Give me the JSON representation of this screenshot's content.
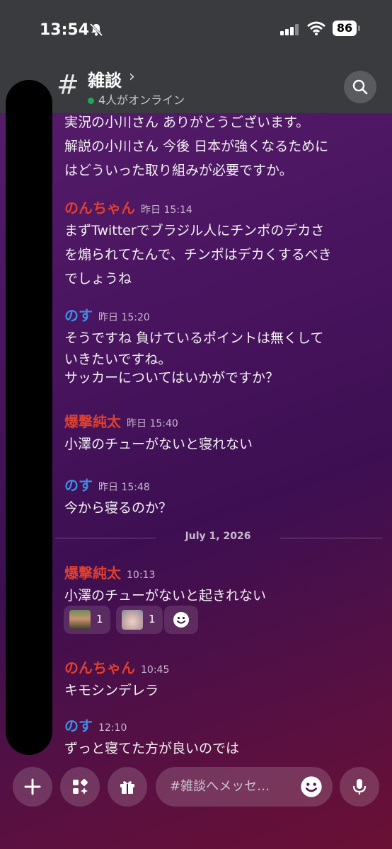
{
  "status": {
    "time": "13:54",
    "battery": "86"
  },
  "header": {
    "channel": "雑談",
    "online": "4人がオンライン"
  },
  "messages": [
    {
      "author": "",
      "time": "",
      "lines": [
        "実況の小川さん ありがとうございます。",
        "解説の小川さん 今後 日本が強くなるために",
        "はどういった取り組みが必要ですか。"
      ]
    },
    {
      "author": "のんちゃん",
      "time": "昨日 15:14",
      "color": "#e0402e",
      "lines": [
        "まずTwitterでブラジル人にチンポのデカさ",
        "を煽られてたんで、チンポはデカくするべき",
        "でしょうね"
      ]
    },
    {
      "author": "のす",
      "time": "昨日 15:20",
      "color": "#3d8de8",
      "lines": [
        "そうですね 負けているポイントは無くして",
        "いきたいですね。",
        "サッカーについてはいかがですか？"
      ]
    },
    {
      "author": "爆撃純太",
      "time": "昨日 15:40",
      "color": "#e0402e",
      "lines": [
        "小澤のチューがないと寝れない"
      ]
    },
    {
      "author": "のす",
      "time": "昨日 15:48",
      "color": "#3d8de8",
      "lines": [
        "今から寝るのか？"
      ]
    },
    {
      "author": "爆撃純太",
      "time": "10:13",
      "color": "#e0402e",
      "lines": [
        "小澤のチューがないと起きれない"
      ]
    },
    {
      "author": "のんちゃん",
      "time": "10:45",
      "color": "#e0402e",
      "lines": [
        "キモシンデレラ"
      ]
    },
    {
      "author": "のす",
      "time": "12:10",
      "color": "#3d8de8",
      "lines": [
        "ずっと寝てた方が良いのでは"
      ]
    }
  ],
  "divider": "July 1, 2026",
  "reactions": [
    {
      "count": "1"
    },
    {
      "count": "1"
    }
  ],
  "composer": {
    "placeholder": "#雑談へメッセ…"
  }
}
